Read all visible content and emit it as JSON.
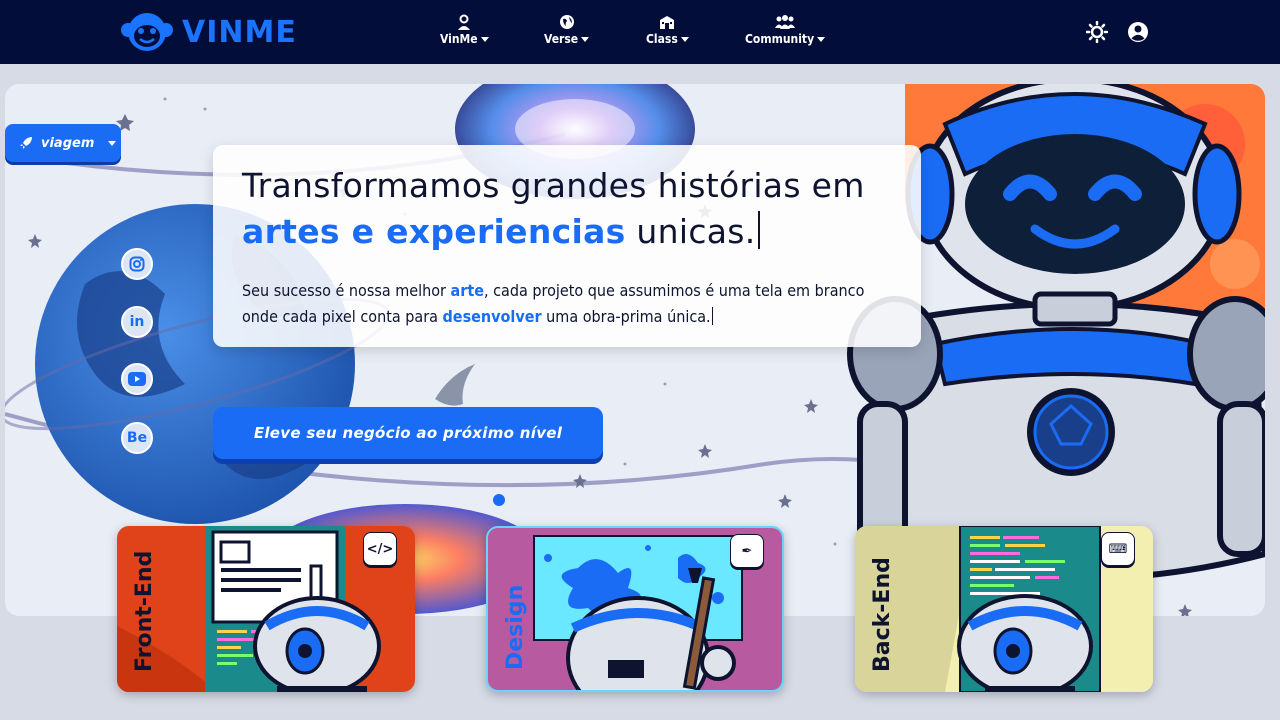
{
  "brand": {
    "name": "VINME"
  },
  "nav": {
    "items": [
      {
        "label": "VinMe",
        "icon": "user-icon"
      },
      {
        "label": "Verse",
        "icon": "globe-icon"
      },
      {
        "label": "Class",
        "icon": "school-icon"
      },
      {
        "label": "Community",
        "icon": "people-icon"
      }
    ],
    "right_icons": [
      "theme-sun-icon",
      "account-icon"
    ]
  },
  "hero": {
    "travel_button": "viagem",
    "headline_parts": [
      "Transformamos grandes histórias em ",
      "artes e experiencias",
      " unicas."
    ],
    "subtext_parts": [
      "Seu sucesso é nossa melhor ",
      "arte",
      ", cada projeto que assumimos é uma tela em branco onde cada pixel conta para ",
      "desenvolver",
      " uma obra-prima única."
    ],
    "cta": "Eleve seu negócio ao próximo nível",
    "social": [
      {
        "name": "instagram-icon",
        "glyph": "◎"
      },
      {
        "name": "linkedin-icon",
        "glyph": "in"
      },
      {
        "name": "youtube-icon",
        "glyph": "▶"
      },
      {
        "name": "behance-icon",
        "glyph": "Be"
      }
    ]
  },
  "cards": [
    {
      "label": "Front-End",
      "icon": "code-icon",
      "glyph": "</>"
    },
    {
      "label": "Design",
      "icon": "pen-icon",
      "glyph": "✒"
    },
    {
      "label": "Back-End",
      "icon": "keyboard-icon",
      "glyph": "⌨"
    }
  ],
  "colors": {
    "accent": "#1a6cf5",
    "navbar": "#030d3a",
    "text": "#0e1430"
  }
}
